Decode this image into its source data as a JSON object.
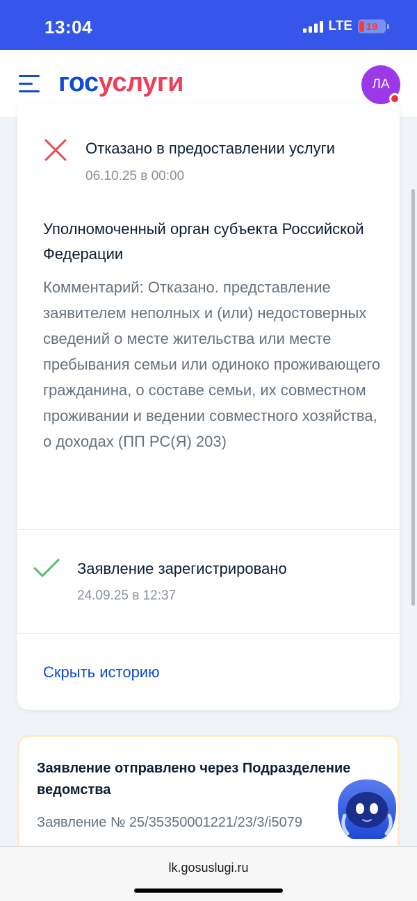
{
  "status_bar": {
    "time": "13:04",
    "network": "LTE",
    "battery": "19"
  },
  "header": {
    "logo_part1": "гос",
    "logo_part2": "услуги",
    "avatar_initials": "ЛА"
  },
  "history": {
    "rejected": {
      "title": "Отказано в предоставлении услуги",
      "date": "06.10.25 в 00:00",
      "organization": "Уполномоченный орган субъекта Российской Федерации",
      "comment": "Комментарий: Отказано. представление заявителем неполных и (или) недостоверных сведений о месте жительства или месте пребывания семьи или одиноко проживающего гражданина, о составе семьи, их совместном проживании и ведении совместного хозяйства, о доходах (ПП РС(Я) 203)"
    },
    "registered": {
      "title": "Заявление зарегистрировано",
      "date": "24.09.25 в 12:37"
    },
    "hide_history_label": "Скрыть историю"
  },
  "application_card": {
    "title": "Заявление отправлено через Подразделение ведомства",
    "number": "Заявление № 25/35350001221/23/3/i5079"
  },
  "browser": {
    "url": "lk.gosuslugi.ru"
  },
  "colors": {
    "status_bar_bg": "#3556e8",
    "brand_blue": "#0d4cd3",
    "brand_red": "#ee3f58",
    "avatar_bg": "#9b38e8",
    "reject_red": "#e04e4e",
    "success_green": "#4fbf6b"
  },
  "icons": {
    "menu": "menu-icon",
    "rejected": "close-icon",
    "registered": "checkmark-icon",
    "assistant": "robot-assistant-icon"
  }
}
